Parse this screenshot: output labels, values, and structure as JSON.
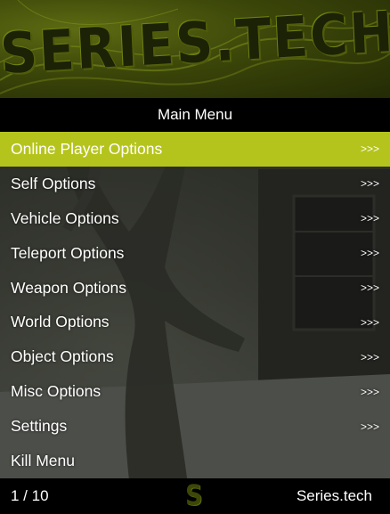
{
  "banner": {
    "logo_text": "SERIES.TECH"
  },
  "menu": {
    "title": "Main Menu",
    "items": [
      {
        "label": "Online Player Options",
        "arrow": ">>>"
      },
      {
        "label": "Self Options",
        "arrow": ">>>"
      },
      {
        "label": "Vehicle Options",
        "arrow": ">>>"
      },
      {
        "label": "Teleport Options",
        "arrow": ">>>"
      },
      {
        "label": "Weapon Options",
        "arrow": ">>>"
      },
      {
        "label": "World Options",
        "arrow": ">>>"
      },
      {
        "label": "Object Options",
        "arrow": ">>>"
      },
      {
        "label": "Misc Options",
        "arrow": ">>>"
      },
      {
        "label": "Settings",
        "arrow": ">>>"
      },
      {
        "label": "Kill Menu",
        "arrow": ""
      }
    ],
    "selected_index": 0
  },
  "footer": {
    "counter": "1 / 10",
    "logo_letter": "S",
    "brand": "Series.tech"
  },
  "colors": {
    "accent": "#b5c41c",
    "bar_background": "#000000",
    "banner_dark": "#232a05"
  }
}
